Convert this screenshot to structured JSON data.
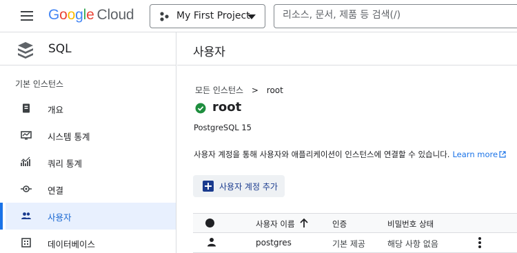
{
  "topbar": {
    "logo_letters": [
      "G",
      "o",
      "o",
      "g",
      "l",
      "e"
    ],
    "logo_suffix": "Cloud",
    "project_name": "My First Project",
    "search_placeholder": "리소스, 문서, 제품 등 검색(/)"
  },
  "sidebar": {
    "product_name": "SQL",
    "section_label": "기본 인스턴스",
    "items": [
      {
        "label": "개요",
        "icon": "overview-icon"
      },
      {
        "label": "시스템 통계",
        "icon": "system-insights-icon"
      },
      {
        "label": "쿼리 통계",
        "icon": "query-insights-icon"
      },
      {
        "label": "연결",
        "icon": "connections-icon"
      },
      {
        "label": "사용자",
        "icon": "users-icon",
        "active": true
      },
      {
        "label": "데이터베이스",
        "icon": "databases-icon"
      }
    ]
  },
  "main": {
    "page_title": "사용자",
    "breadcrumb": {
      "parent": "모든 인스턴스",
      "separator": ">",
      "current": "root"
    },
    "instance_name": "root",
    "db_version": "PostgreSQL 15",
    "description": "사용자 계정을 통해 사용자와 애플리케이션이 인스턴스에 연결할 수 있습니다.",
    "learn_more": "Learn more",
    "add_button_label": "사용자 계정 추가",
    "table": {
      "columns": [
        "사용자 이름",
        "인증",
        "비밀번호 상태"
      ],
      "rows": [
        {
          "username": "postgres",
          "auth": "기본 제공",
          "password_status": "해당 사항 없음"
        }
      ]
    }
  },
  "colors": {
    "accent": "#1a73e8",
    "active_bg": "#e8f0fe",
    "success": "#1e8e3e",
    "button_text": "#1a3b8e"
  }
}
